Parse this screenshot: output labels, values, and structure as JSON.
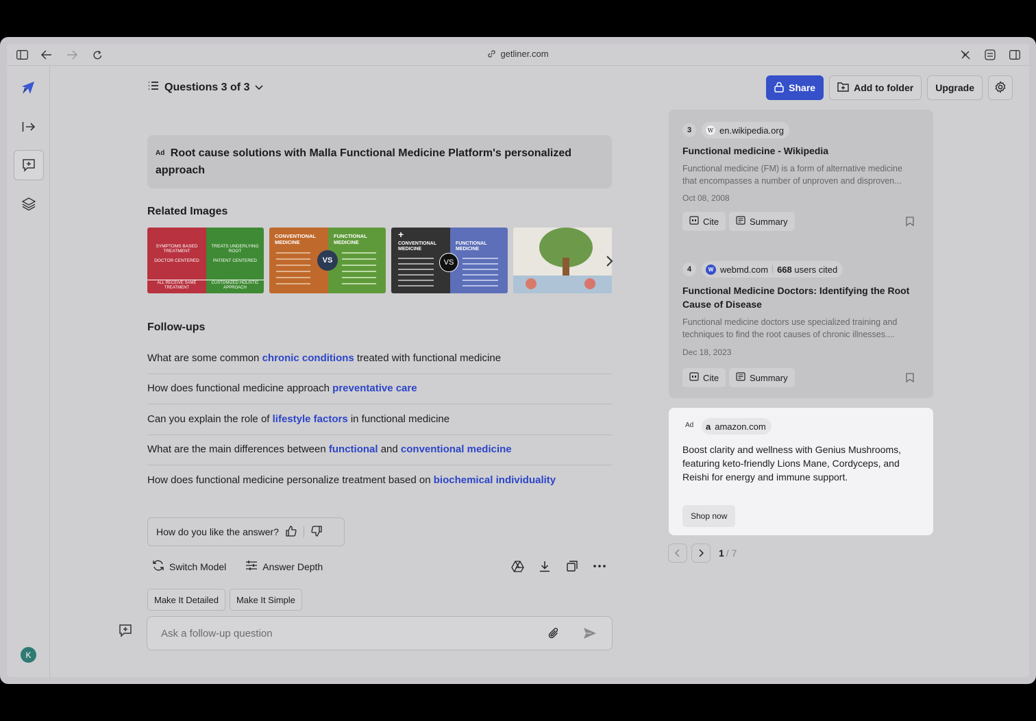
{
  "browser": {
    "url": "getliner.com"
  },
  "header": {
    "questions_label": "Questions 3 of 3",
    "share_label": "Share",
    "add_folder_label": "Add to folder",
    "upgrade_label": "Upgrade"
  },
  "ad_banner": {
    "tag": "Ad",
    "text": "Root cause solutions with Malla Functional Medicine Platform's personalized approach"
  },
  "related_images": {
    "title": "Related Images",
    "images": [
      {
        "left_top": "SYMPTOMS BASED TREATMENT",
        "left_mid": "DOCTOR CENTERED",
        "left_bottom": "ALL RECEIVE SAME TREATMENT",
        "right_top": "TREATS UNDERLYING ROOT",
        "right_mid": "PATIENT CENTERED",
        "right_bottom": "CUSTOMIZED HOLISTIC APPROACH"
      },
      {
        "left_title": "CONVENTIONAL MEDICINE",
        "right_title": "FUNCTIONAL MEDICINE",
        "vs": "VS"
      },
      {
        "left_title": "CONVENTIONAL MEDICINE",
        "right_title": "FUNCTIONAL MEDICINE",
        "vs": "VS"
      }
    ]
  },
  "followups": {
    "title": "Follow-ups",
    "items": [
      {
        "pre": "What are some common ",
        "hl": "chronic conditions",
        "post": " treated with functional medicine"
      },
      {
        "pre": "How does functional medicine approach ",
        "hl": "preventative care",
        "post": ""
      },
      {
        "pre": "Can you explain the role of ",
        "hl": "lifestyle factors",
        "post": " in functional medicine"
      },
      {
        "pre": "What are the main differences between ",
        "hl": "functional",
        "mid": " and ",
        "hl2": "conventional medicine",
        "post": ""
      },
      {
        "pre": "How does functional medicine personalize treatment based on ",
        "hl": "biochemical individuality",
        "post": ""
      }
    ]
  },
  "feedback": {
    "question": "How do you like the answer?"
  },
  "tools": {
    "switch_model": "Switch Model",
    "answer_depth": "Answer Depth"
  },
  "chips": {
    "detailed": "Make It Detailed",
    "simple": "Make It Simple"
  },
  "ask": {
    "placeholder": "Ask a follow-up question"
  },
  "avatar": {
    "initial": "K"
  },
  "sources": [
    {
      "num": "3",
      "domain": "en.wikipedia.org",
      "favicon": "W",
      "title": "Functional medicine - Wikipedia",
      "desc": "Functional medicine (FM) is a form of alternative medicine that encompasses a number of unproven and disproven...",
      "date": "Oct 08, 2008",
      "cite": "Cite",
      "summary": "Summary"
    },
    {
      "num": "4",
      "domain": "webmd.com",
      "favicon": "W",
      "cited_count": "668",
      "cited_suffix": " users cited",
      "title": "Functional Medicine Doctors: Identifying the Root Cause of Disease",
      "desc": "Functional medicine doctors use specialized training and techniques to find the root causes of chronic illnesses....",
      "date": "Dec 18, 2023",
      "cite": "Cite",
      "summary": "Summary"
    }
  ],
  "ad_card": {
    "tag": "Ad",
    "domain": "amazon.com",
    "favicon": "a",
    "text": "Boost clarity and wellness with Genius Mushrooms, featuring keto-friendly Lions Mane, Cordyceps, and Reishi for energy and immune support.",
    "cta": "Shop now"
  },
  "pager": {
    "current": "1",
    "total": "/ 7"
  },
  "colors": {
    "accent": "#3550c9",
    "link": "#2c45c8"
  }
}
